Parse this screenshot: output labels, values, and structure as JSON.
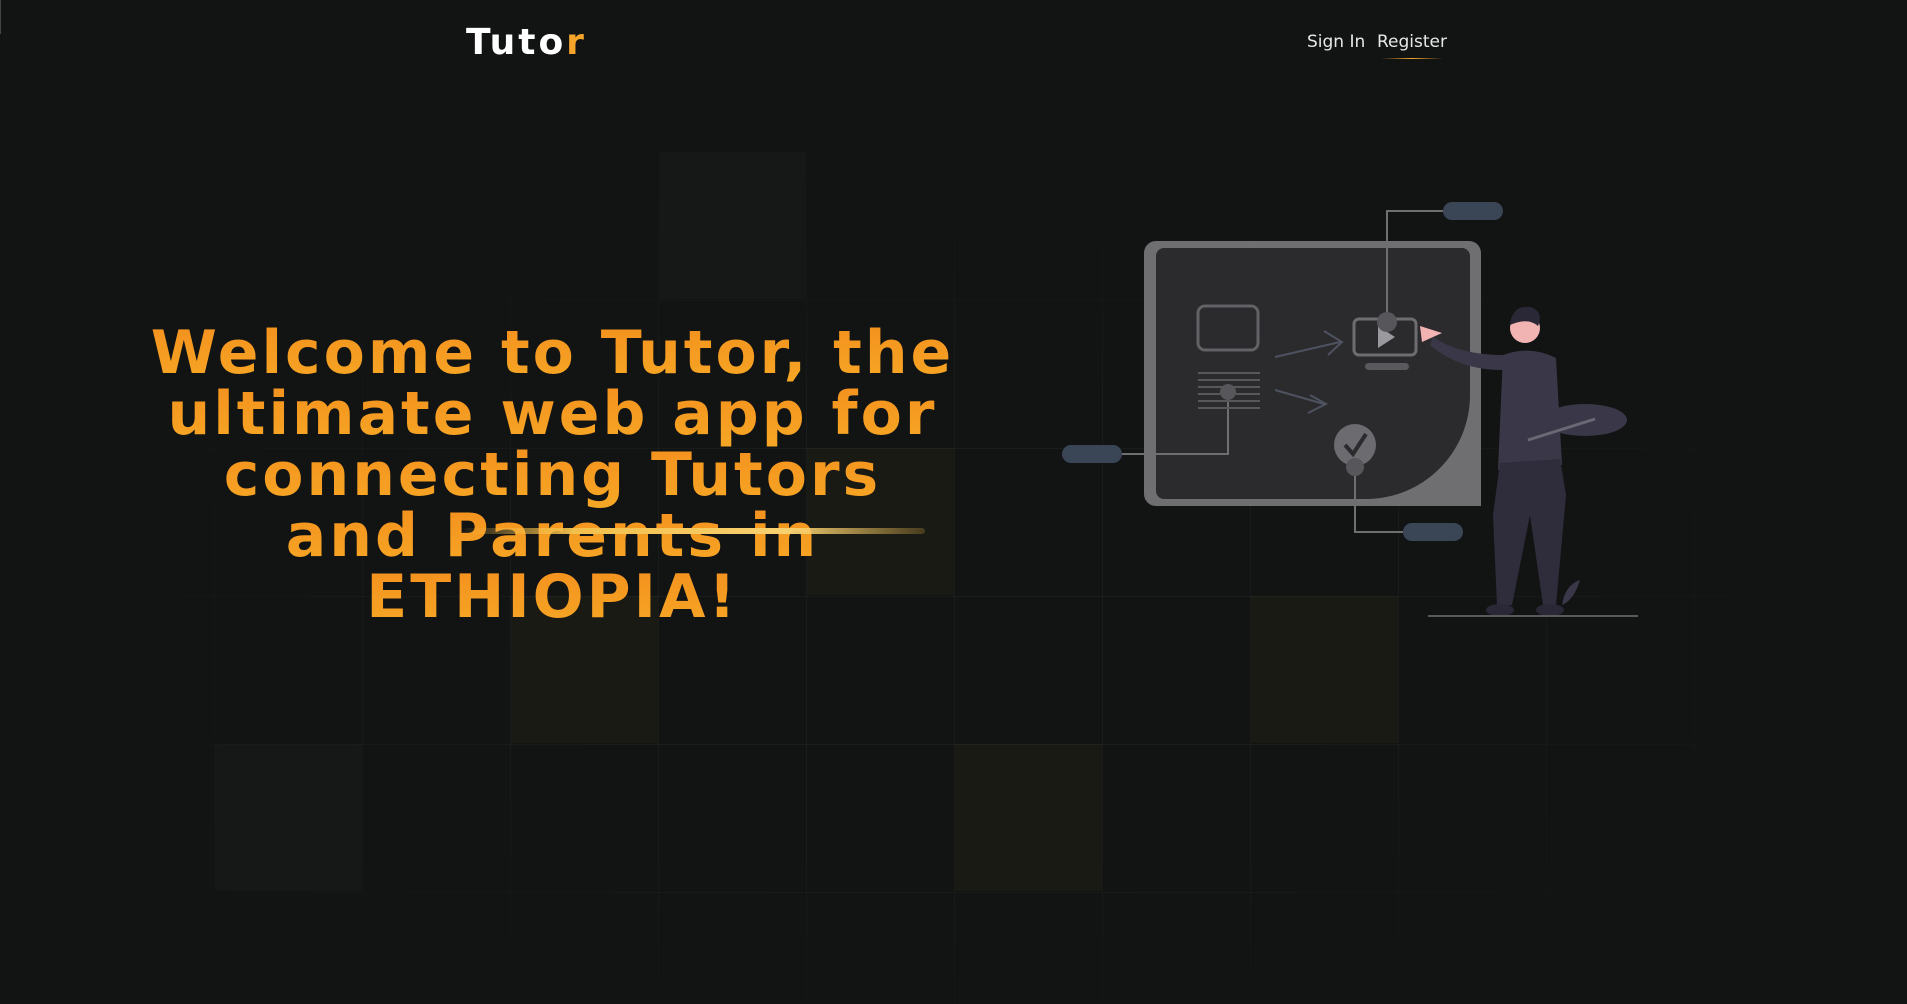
{
  "nav": {
    "logo_main": "Tuto",
    "logo_accent": "r",
    "links": [
      {
        "label": "Sign In"
      },
      {
        "label": "Register"
      }
    ]
  },
  "hero": {
    "headline": "Welcome to Tutor, the ultimate web app for connecting Tutors and Parents in ETHIOPIA!"
  },
  "colors": {
    "background": "#121414",
    "accent": "#f7a52a",
    "headline_start": "#f48f1e",
    "headline_end": "#f6a825"
  }
}
